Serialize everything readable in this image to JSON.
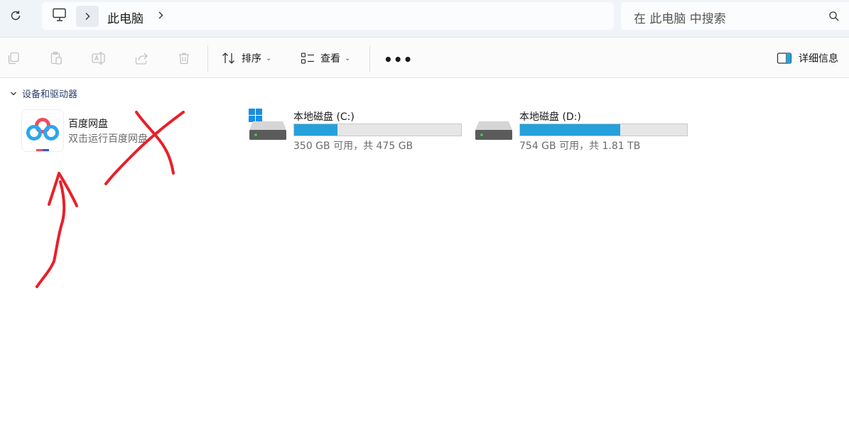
{
  "address": {
    "crumb": "此电脑"
  },
  "search": {
    "placeholder": "在 此电脑 中搜索"
  },
  "toolbar": {
    "sort_label": "排序",
    "view_label": "查看",
    "more_label": "•••",
    "details_label": "详细信息"
  },
  "group": {
    "title": "设备和驱动器"
  },
  "items": {
    "baidu": {
      "name": "百度网盘",
      "subtitle": "双击运行百度网盘"
    },
    "drive_c": {
      "name": "本地磁盘 (C:)",
      "info": "350 GB 可用，共 475 GB",
      "used_fraction": 0.26
    },
    "drive_d": {
      "name": "本地磁盘 (D:)",
      "info": "754 GB 可用，共 1.81 TB",
      "used_fraction": 0.6
    }
  },
  "colors": {
    "accent": "#26a0da",
    "annotation": "#e8202a"
  }
}
